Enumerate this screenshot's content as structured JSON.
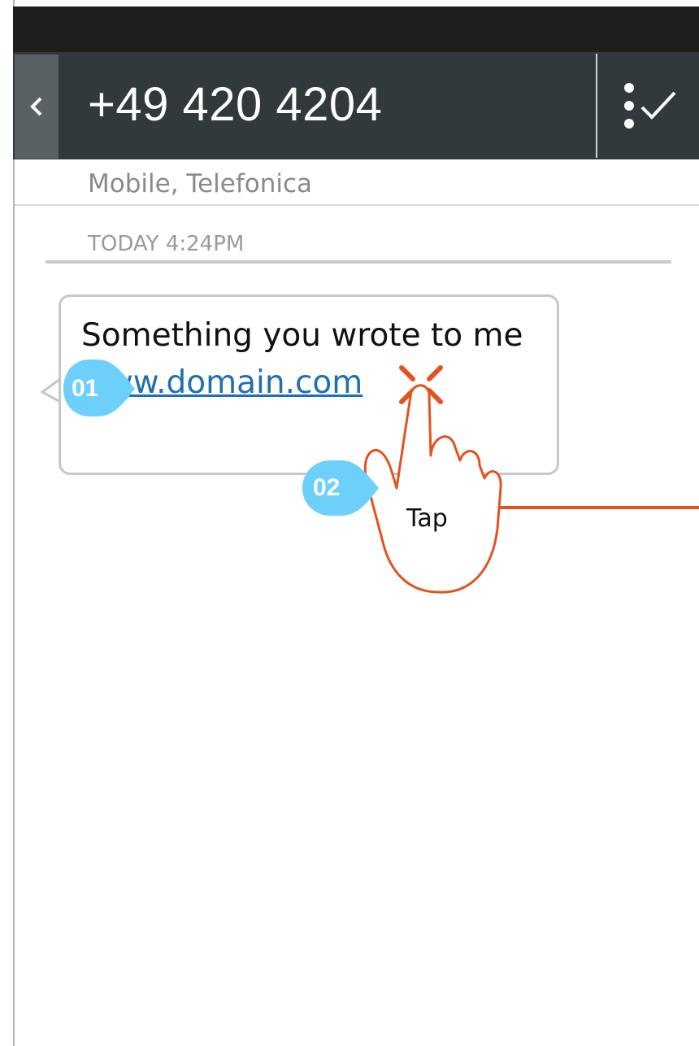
{
  "header": {
    "title": "+49 420 4204"
  },
  "contact": {
    "subtitle": "Mobile, Telefonica"
  },
  "thread": {
    "timestamp": "TODAY 4:24PM",
    "message": {
      "text_before": "Something you wrote to me ",
      "link": "www.domain.com"
    }
  },
  "annotations": {
    "badge_1": "01",
    "badge_2": "02",
    "gesture_label": "Tap"
  },
  "icons": {
    "back": "chevron-left-icon",
    "select": "select-messages-icon",
    "gesture": "hand-tap-icon"
  },
  "colors": {
    "header": "#32393d",
    "status_bar": "#1e1e1c",
    "link": "#1f6fb5",
    "annotation_badge": "#6cd0fb",
    "gesture_stroke": "#e2531e"
  }
}
